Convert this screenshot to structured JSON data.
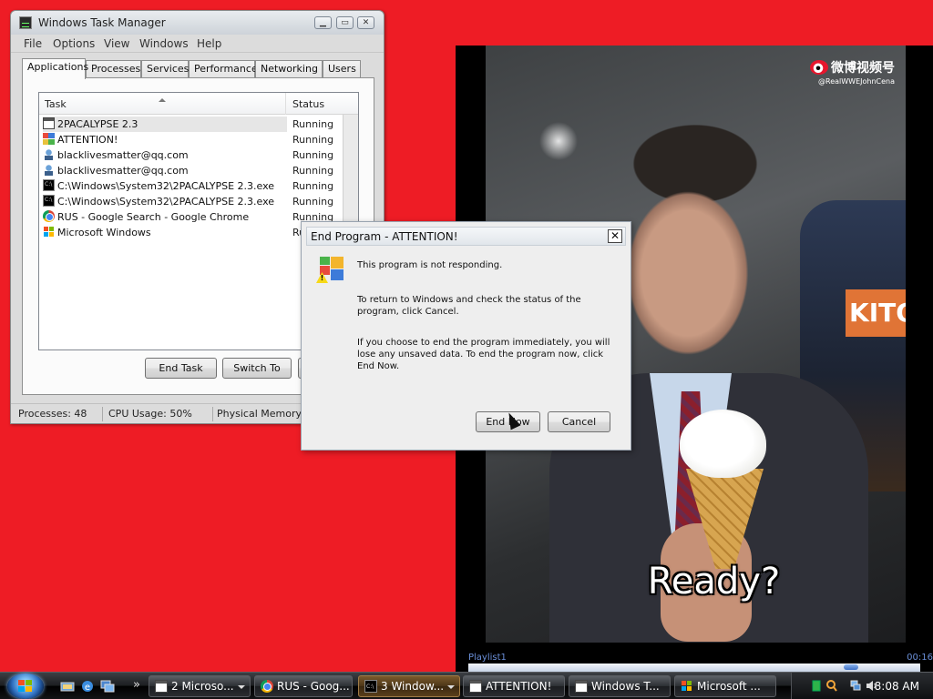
{
  "task_manager": {
    "title": "Windows Task Manager",
    "menu": [
      "File",
      "Options",
      "View",
      "Windows",
      "Help"
    ],
    "tabs": [
      "Applications",
      "Processes",
      "Services",
      "Performance",
      "Networking",
      "Users"
    ],
    "active_tab": "Applications",
    "columns": {
      "task": "Task",
      "status": "Status"
    },
    "rows": [
      {
        "name": "2PACALYPSE 2.3",
        "status": "Running",
        "icon": "app-window-icon",
        "selected": true
      },
      {
        "name": "ATTENTION!",
        "status": "Running",
        "icon": "warning-app-icon"
      },
      {
        "name": "blacklivesmatter@qq.com",
        "status": "Running",
        "icon": "user-icon"
      },
      {
        "name": "blacklivesmatter@qq.com",
        "status": "Running",
        "icon": "user-icon"
      },
      {
        "name": "C:\\Windows\\System32\\2PACALYPSE 2.3.exe",
        "status": "Running",
        "icon": "cmd-icon"
      },
      {
        "name": "C:\\Windows\\System32\\2PACALYPSE 2.3.exe",
        "status": "Running",
        "icon": "cmd-icon"
      },
      {
        "name": "RUS - Google Search - Google Chrome",
        "status": "Running",
        "icon": "chrome-icon"
      },
      {
        "name": "Microsoft Windows",
        "status": "Ru",
        "icon": "windows-icon"
      }
    ],
    "buttons": {
      "end_task": "End Task",
      "switch_to": "Switch To",
      "new_task": "N"
    },
    "statusbar": {
      "processes": "Processes: 48",
      "cpu": "CPU Usage: 50%",
      "memory": "Physical Memory"
    }
  },
  "dialog": {
    "title": "End Program - ATTENTION!",
    "close_glyph": "✕",
    "line1": "This program is not responding.",
    "line2": "To return to Windows and check the status of the program, click Cancel.",
    "line3": "If you choose to end the program immediately, you will lose any unsaved data. To end the program now, click End Now.",
    "end_now": "End Now",
    "cancel": "Cancel"
  },
  "video": {
    "watermark_name": "微博视频号",
    "watermark_handle": "@RealWWEJohnCena",
    "subtitle": "Ready?",
    "sign_text": "KITO",
    "playlist_label": "Playlist1",
    "time": "00:16",
    "progress": 0.83
  },
  "taskbar": {
    "buttons": [
      {
        "label": "2 Microso...",
        "icon": "window-icon",
        "has_arrow": true
      },
      {
        "label": "RUS - Goog...",
        "icon": "chrome-icon",
        "has_arrow": false
      },
      {
        "label": "3 Window...",
        "icon": "cmd-icon",
        "has_arrow": true,
        "active": true
      },
      {
        "label": "ATTENTION!",
        "icon": "window-icon",
        "has_arrow": false
      },
      {
        "label": "Windows T...",
        "icon": "task-manager-icon",
        "has_arrow": false
      },
      {
        "label": "Microsoft ...",
        "icon": "windows-icon",
        "has_arrow": false
      }
    ],
    "clock": "8:08 AM"
  },
  "colors": {
    "desktop": "#ee1c25",
    "taskbar": "#1b1d20",
    "playlist_text": "#6a8fd8"
  }
}
